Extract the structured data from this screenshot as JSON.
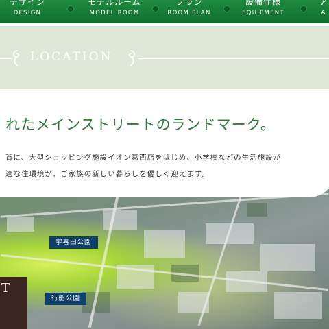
{
  "nav": {
    "items": [
      {
        "jp": "デザイン",
        "en": "DESIGN"
      },
      {
        "jp": "モデルルーム",
        "en": "MODEL ROOM"
      },
      {
        "jp": "プラン",
        "en": "ROOM PLAN"
      },
      {
        "jp": "設備仕様",
        "en": "EQUIPMENT"
      },
      {
        "jp": "ア",
        "en": "A"
      }
    ]
  },
  "location": {
    "title": "LOCATION"
  },
  "headline": "れたメインストリートのランドマーク。",
  "body": [
    "背に、大型ショッピング施設イオン葛西店をはじめ、小学校などの生活施設が",
    "適な住環境が、ご家族の新しい暮らしを優しく迎えます。"
  ],
  "map": {
    "labels": [
      "宇喜田公園",
      "行船公園"
    ],
    "side_box_letter": "T"
  },
  "colors": {
    "nav_green": "#1f8a3f",
    "band": "#dfe8d6",
    "headline_green": "#2d7a3a",
    "label_navy": "#0f3f6a"
  }
}
